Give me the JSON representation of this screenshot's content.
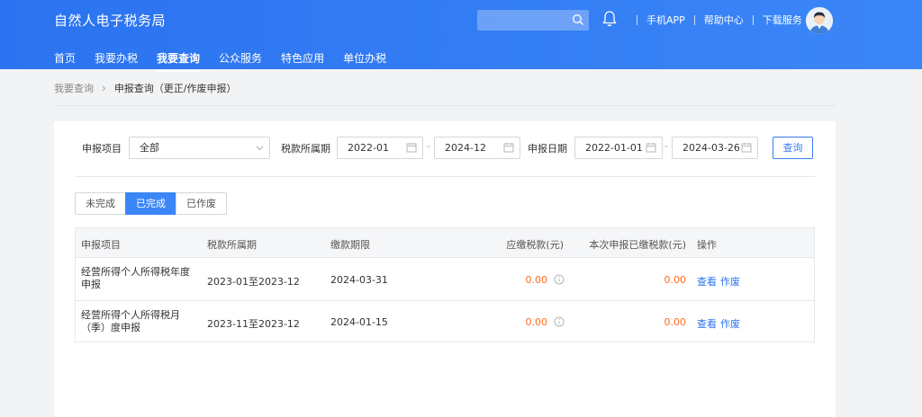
{
  "app": {
    "title": "自然人电子税务局"
  },
  "header": {
    "search_placeholder": "",
    "links": [
      "手机APP",
      "帮助中心",
      "下载服务"
    ]
  },
  "nav": {
    "items": [
      "首页",
      "我要办税",
      "我要查询",
      "公众服务",
      "特色应用",
      "单位办税"
    ],
    "active": "我要查询"
  },
  "breadcrumb": {
    "parent": "我要查询",
    "current": "申报查询（更正/作废申报）"
  },
  "filters": {
    "item_label": "申报项目",
    "item_value": "全部",
    "period_label": "税款所属期",
    "period_start": "2022-01",
    "period_end": "2024-12",
    "date_label": "申报日期",
    "date_start": "2022-01-01",
    "date_end": "2024-03-26",
    "dash": "-",
    "query_button": "查询"
  },
  "tabs": {
    "items": [
      "未完成",
      "已完成",
      "已作废"
    ],
    "active": "已完成"
  },
  "table": {
    "headers": [
      "申报项目",
      "税款所属期",
      "缴款期限",
      "应缴税款(元)",
      "本次申报已缴税款(元)",
      "操作"
    ],
    "rows": [
      {
        "item": "经营所得个人所得税年度申报",
        "period": "2023-01至2023-12",
        "deadline": "2024-03-31",
        "tax_due": "0.00",
        "tax_paid": "0.00",
        "actions": [
          "查看",
          "作废"
        ]
      },
      {
        "item": "经营所得个人所得税月（季）度申报",
        "period": "2023-11至2023-12",
        "deadline": "2024-01-15",
        "tax_due": "0.00",
        "tax_paid": "0.00",
        "actions": [
          "查看",
          "作废"
        ]
      }
    ]
  },
  "icons": {
    "search": "search-icon",
    "bell": "bell-icon",
    "avatar": "user-avatar",
    "calendar": "calendar-icon",
    "dropdown": "chevron-down-icon",
    "info": "info-icon",
    "breadcrumb_separator": "chevron-right-icon"
  },
  "colors": {
    "header_blue": "#2b73f0",
    "accent_blue": "#3b86f7",
    "amount_orange": "#ff6a1a",
    "link_blue": "#2b73f0"
  }
}
